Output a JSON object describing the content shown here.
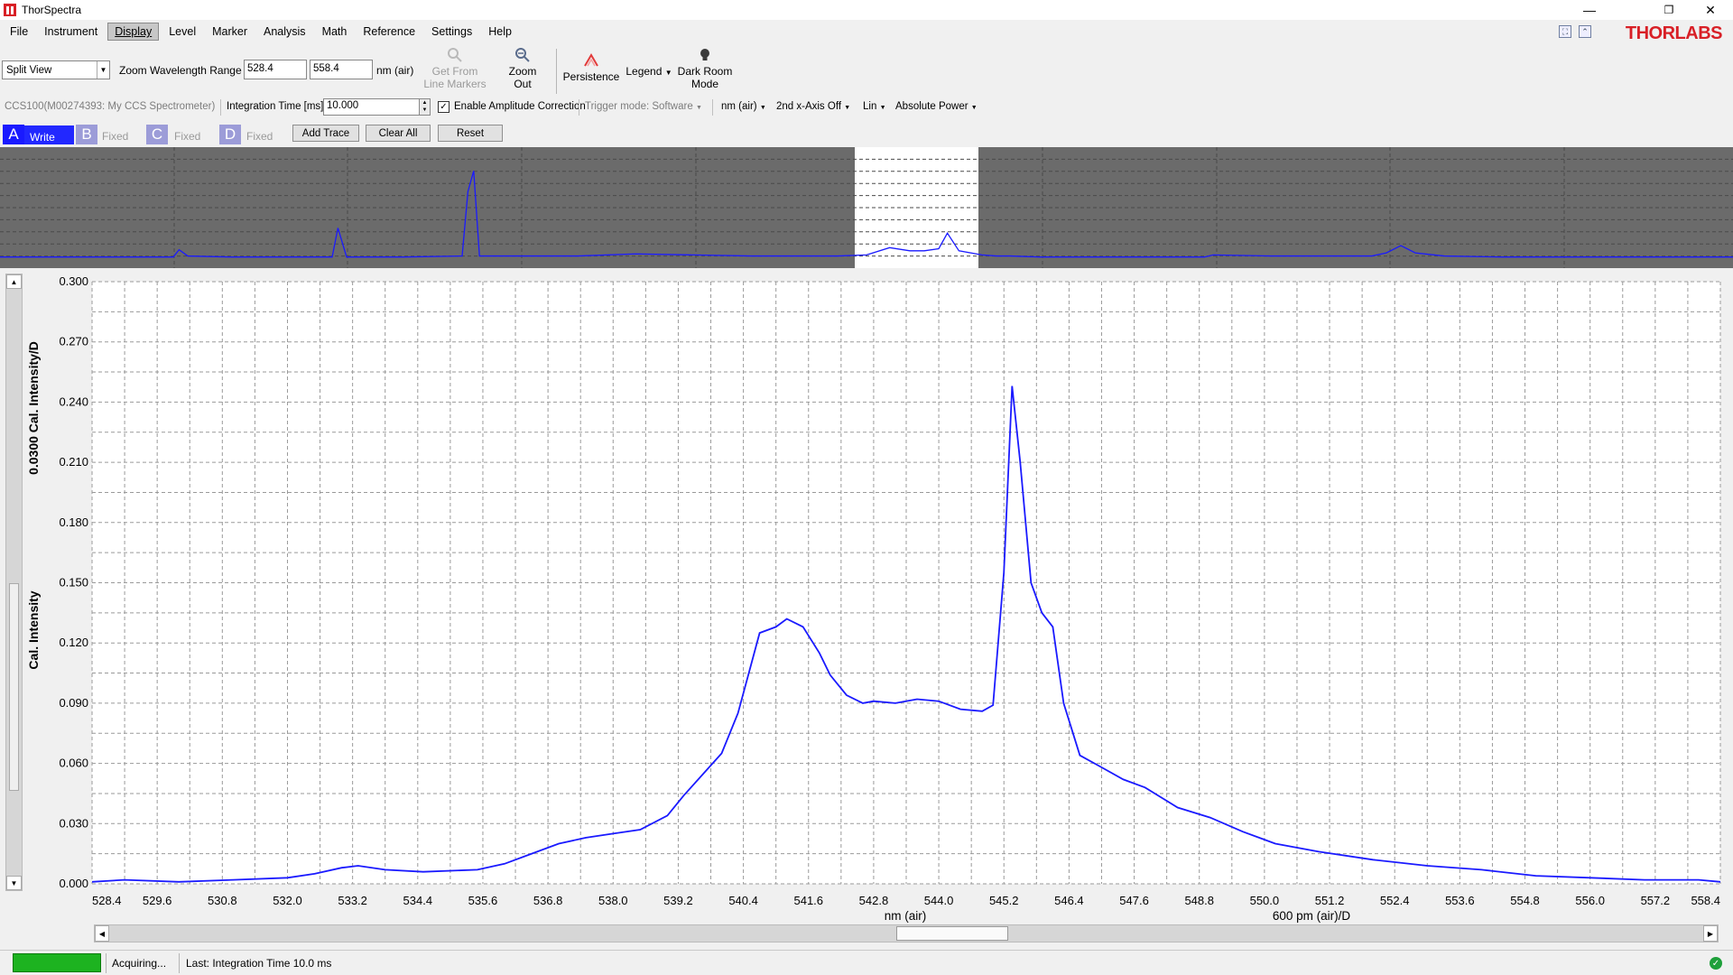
{
  "window": {
    "title": "ThorSpectra",
    "minimize": "—",
    "restore": "❐",
    "close": "✕"
  },
  "brand": "THORLABS",
  "menu": [
    "File",
    "Instrument",
    "Display",
    "Level",
    "Marker",
    "Analysis",
    "Math",
    "Reference",
    "Settings",
    "Help"
  ],
  "menu_active": "Display",
  "toolbar": {
    "view_mode": "Split View",
    "zoom_label": "Zoom Wavelength Range",
    "range_from": "528.4",
    "range_to": "558.4",
    "range_unit": "nm (air)",
    "get_from_markers": [
      "Get From",
      "Line Markers"
    ],
    "zoom_out": [
      "Zoom",
      "Out"
    ],
    "persistence": "Persistence",
    "legend": "Legend",
    "dark_room": [
      "Dark Room",
      "Mode"
    ]
  },
  "settings": {
    "device": "CCS100(M00274393: My CCS Spectrometer)",
    "integration_label": "Integration Time [ms]:",
    "integration_value": "10.000",
    "amplitude_correction": "Enable Amplitude Correction",
    "amplitude_checked": true,
    "trigger_mode": "Trigger mode: Software",
    "unit": "nm (air)",
    "second_axis": "2nd x-Axis Off",
    "scale": "Lin",
    "power": "Absolute Power"
  },
  "traces": [
    {
      "letter": "A",
      "state": "Write",
      "color": "#1a1aff"
    },
    {
      "letter": "B",
      "state": "Fixed",
      "color": "#9c9cd8"
    },
    {
      "letter": "C",
      "state": "Fixed",
      "color": "#9c9cd8"
    },
    {
      "letter": "D",
      "state": "Fixed",
      "color": "#9c9cd8"
    }
  ],
  "trace_buttons": {
    "add": "Add Trace",
    "clear": "Clear All",
    "reset": "Reset"
  },
  "status": {
    "acquiring": "Acquiring...",
    "last": "Last: Integration Time 10.0 ms"
  },
  "chart_data": [
    {
      "type": "line",
      "name": "overview",
      "x_range": [
        500,
        1100
      ],
      "highlight_range": [
        528.4,
        558.4
      ],
      "series": [
        {
          "color": "#1a1aff",
          "x": [
            500,
            560,
            562,
            565,
            580,
            615,
            617,
            620,
            640,
            660,
            662,
            664,
            666,
            700,
            720,
            740,
            760,
            780,
            790,
            800,
            808,
            815,
            820,
            825,
            828,
            832,
            840,
            845,
            850,
            860,
            880,
            900,
            915,
            917,
            920,
            940,
            960,
            975,
            980,
            985,
            990,
            1000,
            1020,
            1040,
            1060,
            1080,
            1100
          ],
          "y": [
            0.02,
            0.02,
            0.09,
            0.03,
            0.02,
            0.02,
            0.3,
            0.02,
            0.02,
            0.03,
            0.65,
            0.85,
            0.03,
            0.03,
            0.05,
            0.04,
            0.03,
            0.03,
            0.03,
            0.04,
            0.11,
            0.08,
            0.08,
            0.1,
            0.25,
            0.08,
            0.04,
            0.03,
            0.03,
            0.02,
            0.02,
            0.02,
            0.02,
            0.02,
            0.04,
            0.03,
            0.03,
            0.03,
            0.06,
            0.13,
            0.06,
            0.03,
            0.02,
            0.02,
            0.02,
            0.02,
            0.02
          ]
        }
      ]
    },
    {
      "type": "line",
      "name": "zoom",
      "xlabel": "nm (air)",
      "secondary_xlabel": "600 pm (air)/D",
      "ylabel": "Cal. Intensity",
      "ylabel_secondary": "0.0300 Cal. Intensity/D",
      "xlim": [
        528.4,
        558.4
      ],
      "ylim": [
        0,
        0.3
      ],
      "xticks": [
        "528.4",
        "529.6",
        "530.8",
        "532.0",
        "533.2",
        "534.4",
        "535.6",
        "536.8",
        "538.0",
        "539.2",
        "540.4",
        "541.6",
        "542.8",
        "544.0",
        "545.2",
        "546.4",
        "547.6",
        "548.8",
        "550.0",
        "551.2",
        "552.4",
        "553.6",
        "554.8",
        "556.0",
        "557.2",
        "558.4"
      ],
      "yticks": [
        "0.000",
        "0.030",
        "0.060",
        "0.090",
        "0.120",
        "0.150",
        "0.180",
        "0.210",
        "0.240",
        "0.270",
        "0.300"
      ],
      "grid": true,
      "series": [
        {
          "color": "#1a1aff",
          "x": [
            528.4,
            529.0,
            530.0,
            531.0,
            532.0,
            532.5,
            533.0,
            533.3,
            533.8,
            534.5,
            535.5,
            536.0,
            536.5,
            537.0,
            537.5,
            538.0,
            538.5,
            539.0,
            539.3,
            539.7,
            540.0,
            540.3,
            540.5,
            540.7,
            541.0,
            541.2,
            541.5,
            541.8,
            542.0,
            542.3,
            542.6,
            542.8,
            543.2,
            543.6,
            544.0,
            544.4,
            544.8,
            545.0,
            545.2,
            545.35,
            545.5,
            545.7,
            545.9,
            546.1,
            546.3,
            546.6,
            547.0,
            547.4,
            547.8,
            548.4,
            549.0,
            549.6,
            550.2,
            551.0,
            552.0,
            553.0,
            554.0,
            555.0,
            556.0,
            557.0,
            557.5,
            558.0,
            558.4
          ],
          "y": [
            0.001,
            0.002,
            0.001,
            0.002,
            0.003,
            0.005,
            0.008,
            0.009,
            0.007,
            0.006,
            0.007,
            0.01,
            0.015,
            0.02,
            0.023,
            0.025,
            0.027,
            0.034,
            0.044,
            0.056,
            0.065,
            0.085,
            0.105,
            0.125,
            0.128,
            0.132,
            0.128,
            0.115,
            0.104,
            0.094,
            0.09,
            0.091,
            0.09,
            0.092,
            0.091,
            0.087,
            0.086,
            0.089,
            0.155,
            0.248,
            0.21,
            0.15,
            0.135,
            0.128,
            0.09,
            0.064,
            0.058,
            0.052,
            0.048,
            0.038,
            0.033,
            0.026,
            0.02,
            0.016,
            0.012,
            0.009,
            0.007,
            0.004,
            0.003,
            0.002,
            0.002,
            0.002,
            0.001
          ]
        }
      ]
    }
  ]
}
